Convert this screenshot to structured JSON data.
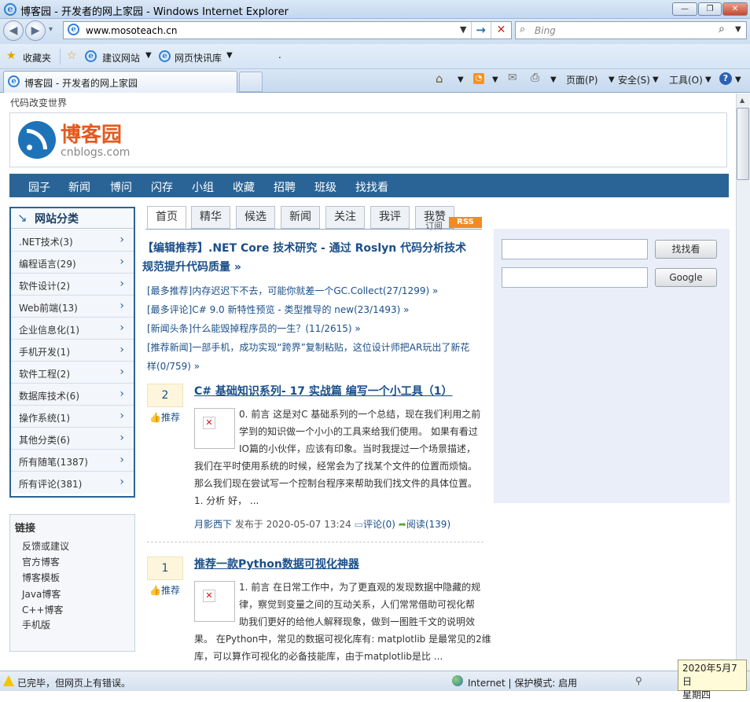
{
  "window": {
    "title": "博客园 - 开发者的网上家园 - Windows Internet Explorer",
    "btn_min": "—",
    "btn_max": "❐",
    "btn_close": "✕"
  },
  "address": {
    "url": "www.mosoteach.cn",
    "search_placeholder": "Bing"
  },
  "favorites": {
    "label": "收藏夹",
    "item1": "建议网站",
    "item2": "网页快讯库",
    "dot": "."
  },
  "tab": {
    "label": "博客园 - 开发者的网上家园"
  },
  "commandbar": {
    "page": "页面(P)",
    "safety": "安全(S)",
    "tools": "工具(O)"
  },
  "page": {
    "slogan": "代码改变世界",
    "logo": {
      "name": "博客园",
      "domain": "cnblogs.com"
    },
    "nav": [
      "园子",
      "新闻",
      "博问",
      "闪存",
      "小组",
      "收藏",
      "招聘",
      "班级",
      "找找看"
    ],
    "sidebar": {
      "title": "网站分类",
      "items": [
        ".NET技术(3)",
        "编程语言(29)",
        "软件设计(2)",
        "Web前端(13)",
        "企业信息化(1)",
        "手机开发(1)",
        "软件工程(2)",
        "数据库技术(6)",
        "操作系统(1)",
        "其他分类(6)",
        "所有随笔(1387)",
        "所有评论(381)"
      ]
    },
    "links": {
      "title": "链接",
      "items": [
        "反馈或建议",
        "官方博客",
        "博客模板",
        "Java博客",
        "C++博客",
        "手机版"
      ]
    },
    "tabs": [
      "首页",
      "精华",
      "候选",
      "新闻",
      "关注",
      "我评",
      "我赞"
    ],
    "tab_subscript": "订阅",
    "rss": "RSS",
    "editor_pick": {
      "line1": "【编辑推荐】.NET Core 技术研究 - 通过 Roslyn 代码分析技术",
      "line2": "规范提升代码质量 »"
    },
    "picks": [
      "[最多推荐]内存迟迟下不去，可能你就差一个GC.Collect(27/1299) »",
      "[最多评论]C# 9.0 新特性预览 - 类型推导的 new(23/1493) »",
      "[新闻头条]什么能毁掉程序员的一生？(11/2615) »",
      "[推荐新闻]一部手机，成功实现“跨界”复制粘贴，这位设计师把AR玩出了新花",
      "样(0/759) »"
    ],
    "posts": [
      {
        "digg": "2",
        "recommend": "推荐",
        "title": "C# 基础知识系列- 17 实战篇 编写一个小工具（1）",
        "summary": [
          "0. 前言 这是对C 基础系列的一个总结，现在我们利用之前",
          "学到的知识做一个小小的工具来给我们使用。 如果有看过",
          "IO篇的小伙伴，应该有印象。当时我提过一个场景描述，",
          "我们在平时使用系统的时候，经常会为了找某个文件的位置而烦恼。",
          "那么我们现在尝试写一个控制台程序来帮助我们找文件的具体位置。",
          "1. 分析 好，  ..."
        ],
        "author": "月影西下",
        "published": "发布于 2020-05-07 13:24",
        "comments": "评论(0)",
        "reads": "阅读(139)"
      },
      {
        "digg": "1",
        "recommend": "推荐",
        "title": "推荐一款Python数据可视化神器",
        "summary": [
          "1. 前言 在日常工作中，为了更直观的发现数据中隐藏的规",
          "律，察觉到变量之间的互动关系，人们常常借助可视化帮",
          "助我们更好的给他人解释现象，做到一图胜千文的说明效",
          "果。 在Python中，常见的数据可视化库有: matplotlib 是最常见的2维",
          "库，可以算作可视化的必备技能库，由于matplotlib是比 ..."
        ]
      }
    ],
    "right": {
      "search_btn1": "找找看",
      "search_btn2": "Google"
    }
  },
  "status": {
    "text": "已完毕，但网页上有错误。",
    "zone": "Internet | 保护模式: 启用"
  },
  "clock": {
    "date": "2020年5月7日",
    "weekday": "星期四"
  }
}
